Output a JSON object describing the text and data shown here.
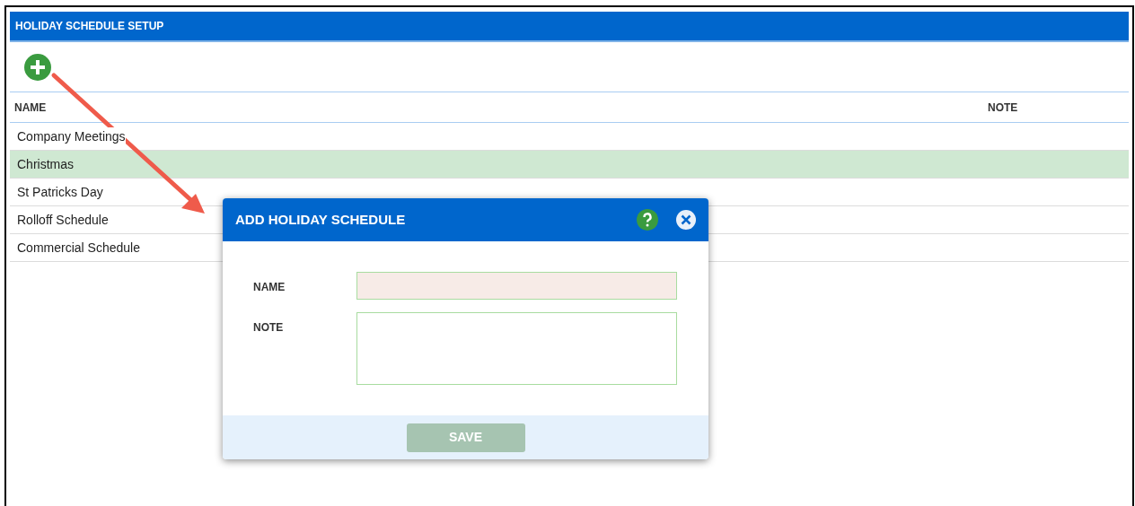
{
  "panel": {
    "title": "HOLIDAY SCHEDULE SETUP"
  },
  "table": {
    "columns": [
      "NAME",
      "NOTE"
    ],
    "rows": [
      {
        "name": "Company Meetings",
        "selected": false
      },
      {
        "name": "Christmas",
        "selected": true
      },
      {
        "name": "St Patricks Day",
        "selected": false
      },
      {
        "name": "Rolloff Schedule",
        "selected": false
      },
      {
        "name": "Commercial Schedule",
        "selected": false
      }
    ]
  },
  "dialog": {
    "title": "ADD HOLIDAY SCHEDULE",
    "fields": [
      {
        "kind": "text",
        "label": "NAME",
        "invalid": true
      },
      {
        "kind": "textarea",
        "label": "NOTE",
        "invalid": false
      }
    ],
    "save_button": {
      "label": "SAVE",
      "disabled": true
    }
  }
}
